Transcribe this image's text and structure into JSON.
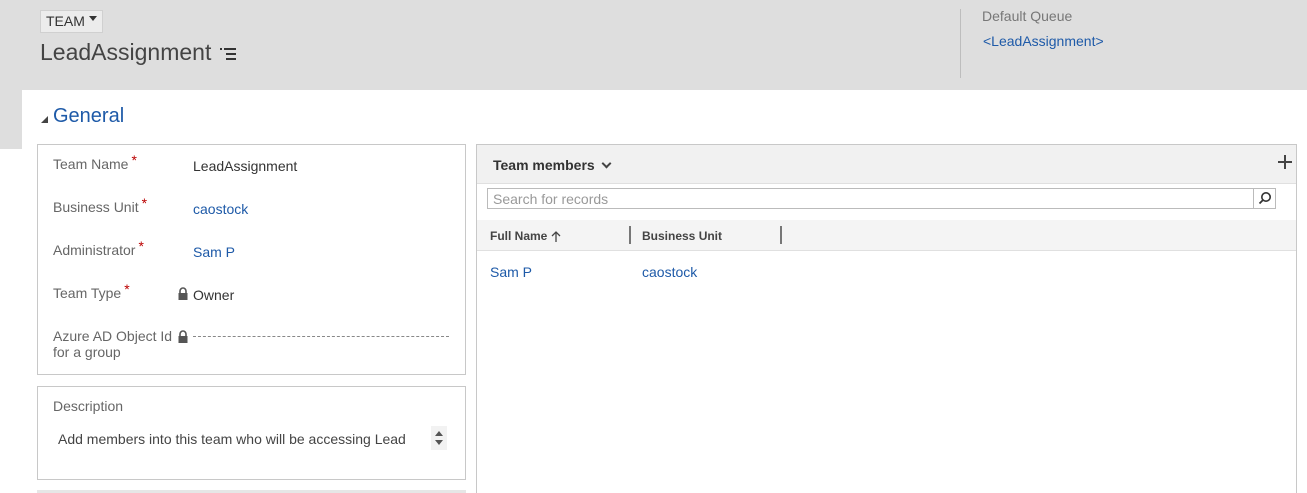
{
  "header": {
    "entity_type": "TEAM",
    "record_title": "LeadAssignment",
    "header_fields": [
      {
        "label": "Default Queue",
        "value": "<LeadAssignment>"
      }
    ]
  },
  "section": {
    "title": "General"
  },
  "form": {
    "fields": [
      {
        "label": "Team Name",
        "required": "*",
        "value": "LeadAssignment"
      },
      {
        "label": "Business Unit",
        "required": "*",
        "value": "caostock"
      },
      {
        "label": "Administrator",
        "required": "*",
        "value": "Sam P"
      },
      {
        "label": "Team Type",
        "required": "*",
        "value": "Owner"
      },
      {
        "label_line1": "Azure AD Object Id",
        "label_line2": "for a group",
        "value": ""
      }
    ],
    "description": {
      "label": "Description",
      "value": "Add members into this team who will be accessing Lead"
    }
  },
  "subgrid": {
    "title": "Team members",
    "search_placeholder": "Search for records",
    "columns": [
      "Full Name",
      "Business Unit"
    ],
    "rows": [
      {
        "full_name": "Sam P",
        "business_unit": "caostock"
      }
    ]
  },
  "icons": {
    "entity_menu": "chevron-down-icon",
    "form_menu": "list-menu-icon",
    "section_toggle": "collapse-triangle-icon",
    "lock": "lock-icon",
    "add": "plus-icon",
    "search": "search-icon",
    "sort": "arrow-up-icon"
  },
  "colors": {
    "header_bg": "#dedede",
    "link": "#1e5aa8",
    "required": "#bb0000"
  }
}
